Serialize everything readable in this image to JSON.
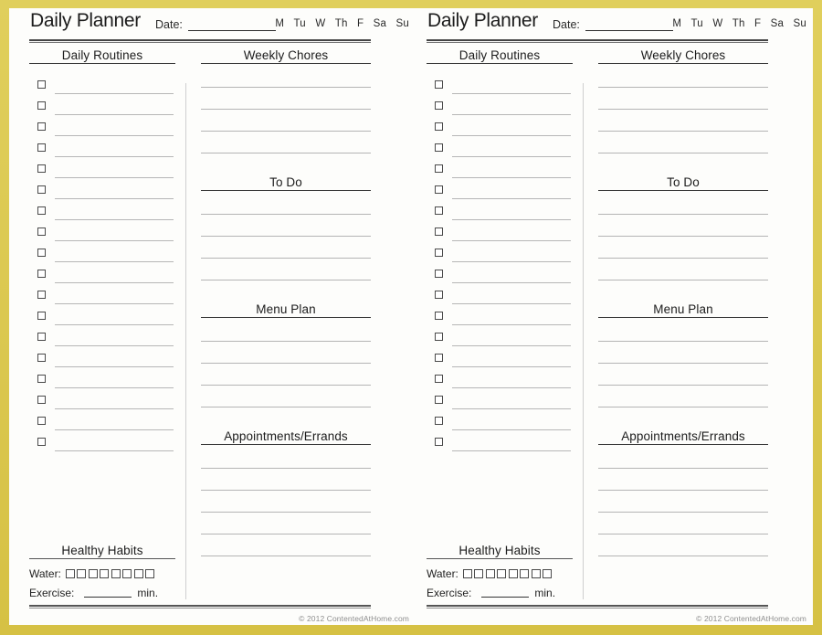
{
  "document": {
    "type": "printable-daily-planner",
    "pages": 2,
    "border_color": "#d8c34a",
    "paper_color": "#fdfdfb"
  },
  "planner": {
    "title": "Daily Planner",
    "date_label": "Date:",
    "weekdays": [
      "M",
      "Tu",
      "W",
      "Th",
      "F",
      "Sa",
      "Su"
    ],
    "sections": {
      "daily_routines": {
        "heading": "Daily Routines",
        "checkbox_rows": 18
      },
      "weekly_chores": {
        "heading": "Weekly Chores",
        "lines": 5
      },
      "to_do": {
        "heading": "To Do",
        "lines": 5
      },
      "menu_plan": {
        "heading": "Menu Plan",
        "lines": 5
      },
      "appointments": {
        "heading": "Appointments/Errands",
        "lines": 5
      },
      "healthy_habits": {
        "heading": "Healthy Habits",
        "water_label": "Water:",
        "water_boxes": 8,
        "exercise_label": "Exercise:",
        "exercise_unit": "min."
      }
    },
    "footer": {
      "copyright": "© 2012 ContentedAtHome.com"
    }
  }
}
